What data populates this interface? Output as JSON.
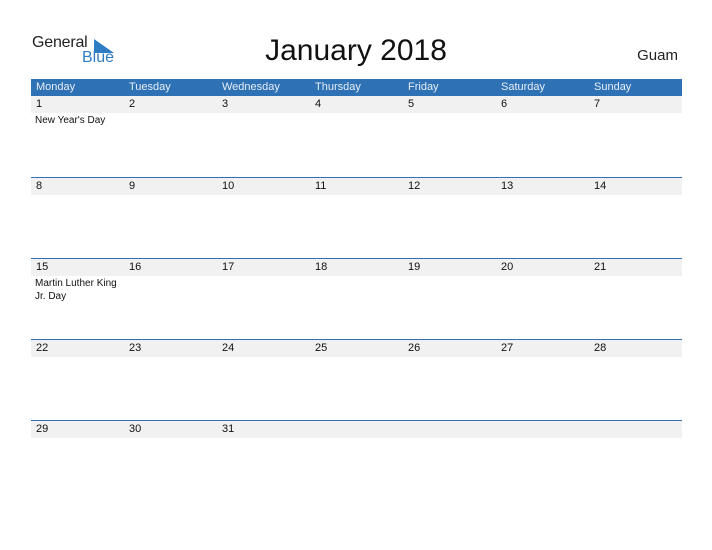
{
  "logo": {
    "general": "General",
    "blue": "Blue"
  },
  "title": "January 2018",
  "region": "Guam",
  "weekdays": [
    "Monday",
    "Tuesday",
    "Wednesday",
    "Thursday",
    "Friday",
    "Saturday",
    "Sunday"
  ],
  "weeks": [
    {
      "days": [
        "1",
        "2",
        "3",
        "4",
        "5",
        "6",
        "7"
      ],
      "events": [
        "New Year's Day",
        "",
        "",
        "",
        "",
        "",
        ""
      ]
    },
    {
      "days": [
        "8",
        "9",
        "10",
        "11",
        "12",
        "13",
        "14"
      ],
      "events": [
        "",
        "",
        "",
        "",
        "",
        "",
        ""
      ]
    },
    {
      "days": [
        "15",
        "16",
        "17",
        "18",
        "19",
        "20",
        "21"
      ],
      "events": [
        "Martin Luther King Jr. Day",
        "",
        "",
        "",
        "",
        "",
        ""
      ]
    },
    {
      "days": [
        "22",
        "23",
        "24",
        "25",
        "26",
        "27",
        "28"
      ],
      "events": [
        "",
        "",
        "",
        "",
        "",
        "",
        ""
      ]
    },
    {
      "days": [
        "29",
        "30",
        "31",
        "",
        "",
        "",
        ""
      ],
      "events": [
        "",
        "",
        "",
        "",
        "",
        "",
        ""
      ]
    }
  ],
  "colors": {
    "header_bg": "#2e72b5",
    "brand_blue": "#2e7cc4",
    "date_strip": "#f1f1f1"
  }
}
